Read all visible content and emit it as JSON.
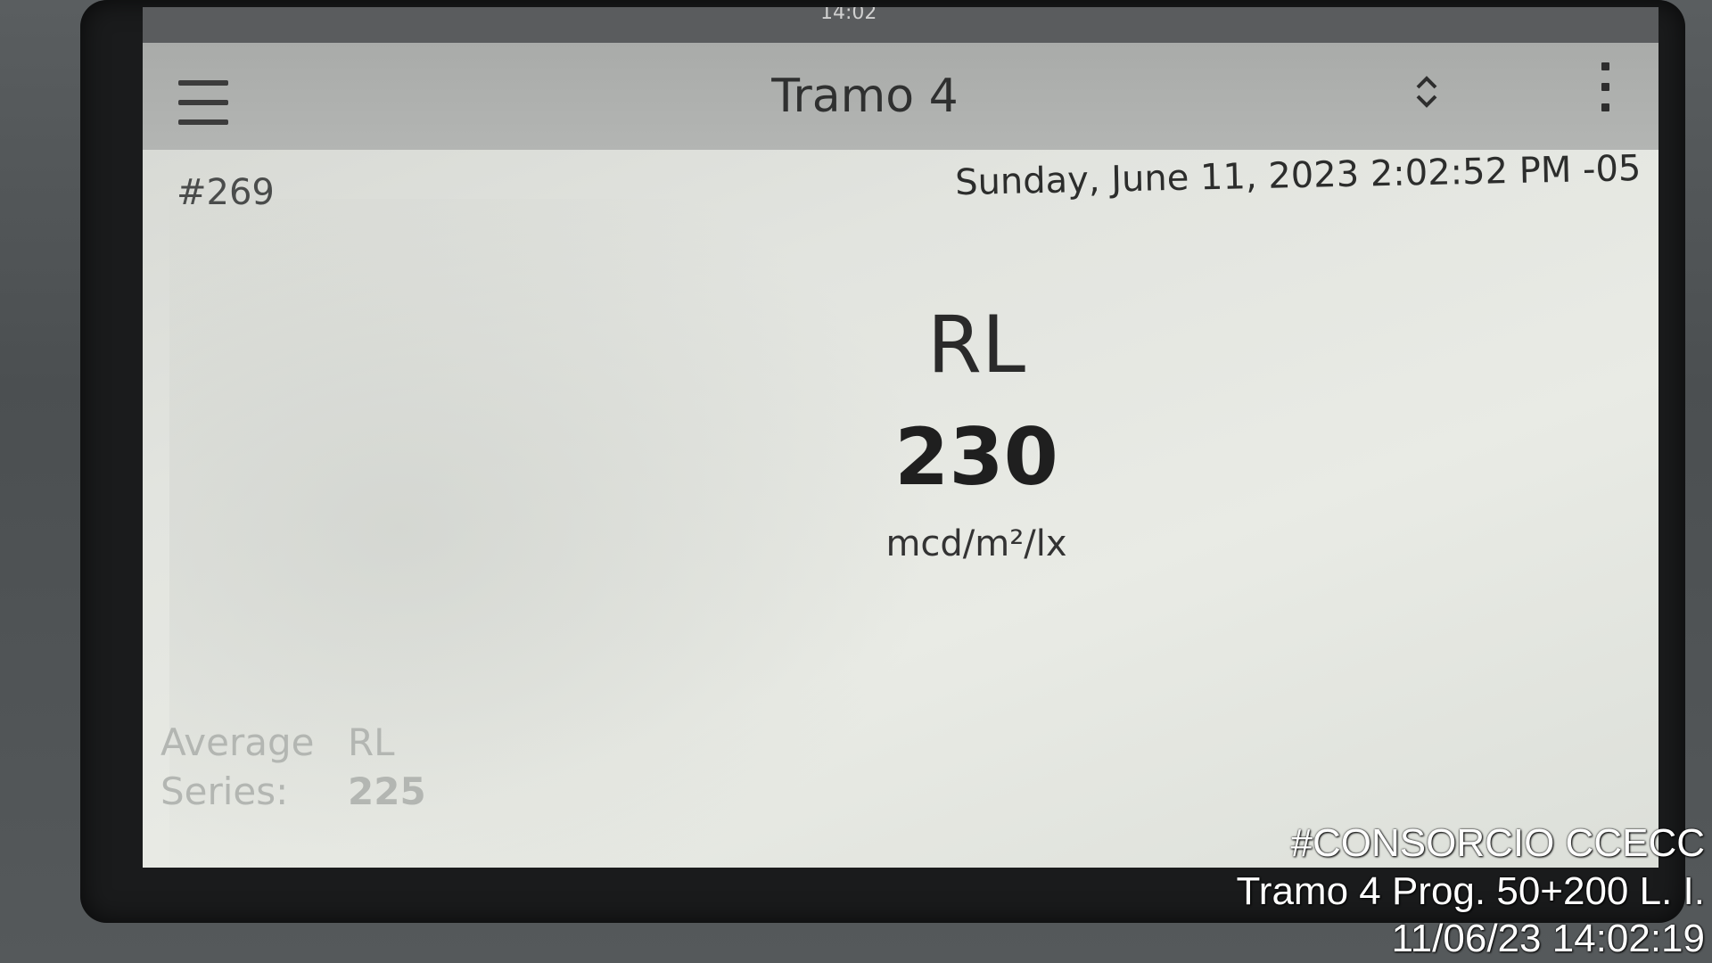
{
  "device": {
    "status_time": "14:02",
    "header": {
      "title": "Tramo 4"
    },
    "record_number": "#269",
    "datetime": "Sunday, June 11, 2023 2:02:52 PM -05",
    "reading": {
      "label": "RL",
      "value": "230",
      "unit": "mcd/m²/lx"
    },
    "average": {
      "label_line1": "Average",
      "label_line2": "Series:",
      "column_label": "RL",
      "value": "225"
    }
  },
  "watermark": {
    "line1": "#CONSORCIO CCECC",
    "line2": "Tramo 4 Prog. 50+200 L. I.",
    "line3": "11/06/23  14:02:19"
  },
  "icons": {
    "menu": "hamburger-menu-icon",
    "sort": "sort-chevrons-icon",
    "more": "more-vertical-icon"
  }
}
